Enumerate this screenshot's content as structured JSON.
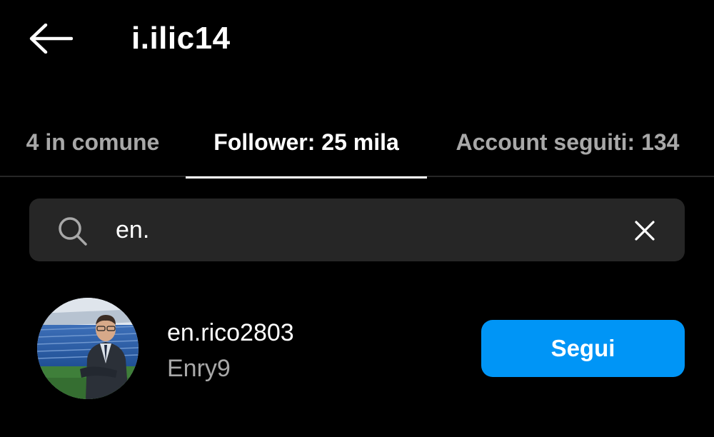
{
  "header": {
    "back_icon": "arrow-left-icon",
    "title": "i.ilic14"
  },
  "tabs": [
    {
      "label": "4 in comune",
      "active": false
    },
    {
      "label": "Follower: 25 mila",
      "active": true
    },
    {
      "label": "Account seguiti: 134",
      "active": false
    }
  ],
  "search": {
    "icon": "search-icon",
    "value": "en.",
    "clear_icon": "close-icon"
  },
  "results": [
    {
      "username": "en.rico2803",
      "full_name": "Enry9",
      "avatar_icon": "profile-photo",
      "follow_label": "Segui"
    }
  ],
  "colors": {
    "background": "#000000",
    "search_bg": "#262626",
    "secondary_text": "#a8a8a8",
    "follow_button": "#0095f6"
  }
}
